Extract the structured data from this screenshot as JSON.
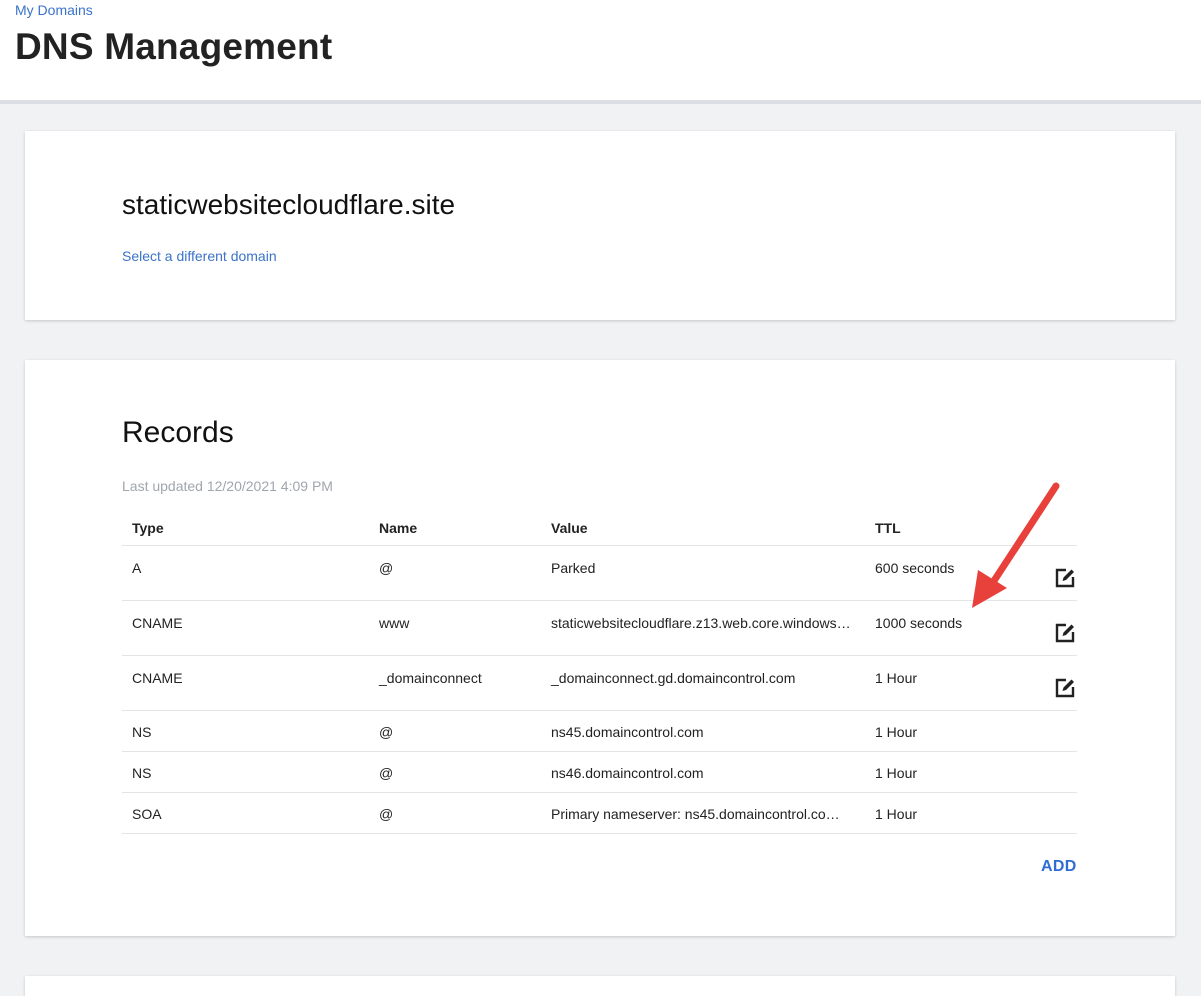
{
  "header": {
    "breadcrumb": "My Domains",
    "title": "DNS Management"
  },
  "domain_card": {
    "domain_name": "staticwebsitecloudflare.site",
    "select_link": "Select a different domain"
  },
  "records": {
    "title": "Records",
    "last_updated": "Last updated 12/20/2021 4:09 PM",
    "columns": [
      "Type",
      "Name",
      "Value",
      "TTL"
    ],
    "rows": [
      {
        "type": "A",
        "name": "@",
        "value": "Parked",
        "ttl": "600 seconds",
        "editable": true
      },
      {
        "type": "CNAME",
        "name": "www",
        "value": "staticwebsitecloudflare.z13.web.core.windows…",
        "ttl": "1000 seconds",
        "editable": true
      },
      {
        "type": "CNAME",
        "name": "_domainconnect",
        "value": "_domainconnect.gd.domaincontrol.com",
        "ttl": "1 Hour",
        "editable": true
      },
      {
        "type": "NS",
        "name": "@",
        "value": "ns45.domaincontrol.com",
        "ttl": "1 Hour",
        "editable": false
      },
      {
        "type": "NS",
        "name": "@",
        "value": "ns46.domaincontrol.com",
        "ttl": "1 Hour",
        "editable": false
      },
      {
        "type": "SOA",
        "name": "@",
        "value": "Primary nameserver: ns45.domaincontrol.co…",
        "ttl": "1 Hour",
        "editable": false
      }
    ],
    "add_label": "ADD"
  },
  "colors": {
    "link": "#3a73c9",
    "add_button": "#2f6dd3",
    "annotation_arrow": "#e8403a",
    "background": "#f1f2f4"
  },
  "icons": {
    "edit": "edit-icon",
    "annotation": "arrow-annotation-icon"
  }
}
